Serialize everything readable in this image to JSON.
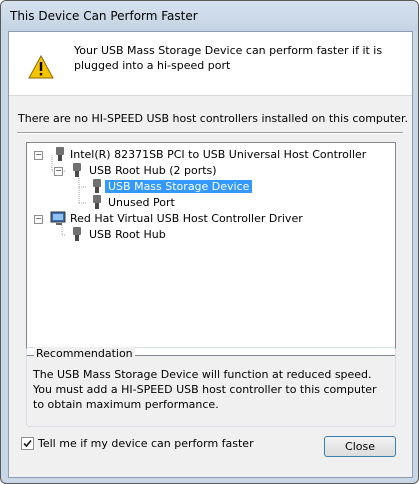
{
  "window": {
    "title": "This Device Can Perform Faster"
  },
  "banner": {
    "icon": "warning-icon",
    "message": "Your USB Mass Storage Device can perform faster if it is plugged into a hi-speed port"
  },
  "status_text": "There are no HI-SPEED USB host controllers installed on this computer.",
  "tree": {
    "items": [
      {
        "label": "Intel(R) 82371SB PCI to USB Universal Host Controller",
        "toggle": "−",
        "icon": "usb-plug-icon"
      },
      {
        "label": "USB Root Hub (2 ports)",
        "toggle": "−",
        "icon": "usb-plug-icon"
      },
      {
        "label": "USB Mass Storage Device",
        "icon": "usb-plug-icon",
        "selected": true
      },
      {
        "label": "Unused Port",
        "icon": "usb-plug-icon"
      },
      {
        "label": "Red Hat Virtual USB Host Controller Driver",
        "toggle": "−",
        "icon": "computer-icon"
      },
      {
        "label": "USB Root Hub",
        "icon": "usb-plug-icon"
      }
    ]
  },
  "recommendation": {
    "title": "Recommendation",
    "text": "The USB Mass Storage Device will function at reduced speed. You must add a HI-SPEED USB host controller to this computer to obtain maximum performance."
  },
  "checkbox": {
    "label": "Tell me if my device can perform faster",
    "checked": true
  },
  "buttons": {
    "close": "Close"
  },
  "colors": {
    "selection": "#3399ff",
    "warning": "#f5c400"
  }
}
